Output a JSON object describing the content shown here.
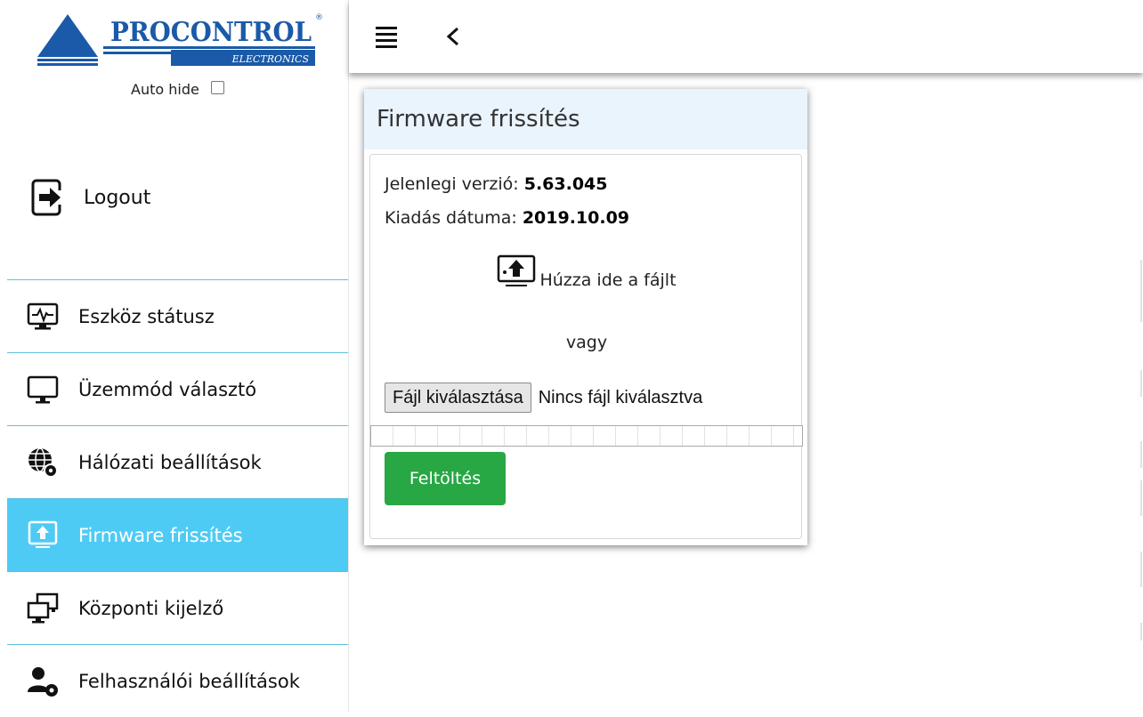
{
  "brand": {
    "name": "PROCONTROL",
    "sub": "ELECTRONICS",
    "mark": "®"
  },
  "sidebar": {
    "autohide_label": "Auto hide",
    "autohide_checked": false,
    "logout_label": "Logout",
    "items": [
      {
        "label": "Eszköz státusz",
        "icon": "monitor-pulse-icon"
      },
      {
        "label": "Üzemmód választó",
        "icon": "monitor-icon"
      },
      {
        "label": "Hálózati beállítások",
        "icon": "globe-gear-icon"
      },
      {
        "label": "Firmware frissítés",
        "icon": "upload-monitor-icon",
        "active": true
      },
      {
        "label": "Központi kijelző",
        "icon": "dual-monitor-icon"
      },
      {
        "label": "Felhasználói beállítások",
        "icon": "user-gear-icon"
      }
    ]
  },
  "card": {
    "title": "Firmware frissítés",
    "version_label": "Jelenlegi verzió: ",
    "version_value": "5.63.045",
    "date_label": "Kiadás dátuma: ",
    "date_value": "2019.10.09",
    "drop_text": "Húzza ide a fájlt",
    "or_text": "vagy",
    "file_button": "Fájl kiválasztása",
    "file_status": "Nincs fájl kiválasztva",
    "progress_percent": 0,
    "upload_button": "Feltöltés"
  },
  "colors": {
    "accent": "#4ecbf5",
    "divider": "#5bc0de",
    "upload": "#28a745",
    "brand_blue": "#1a5aa8"
  }
}
